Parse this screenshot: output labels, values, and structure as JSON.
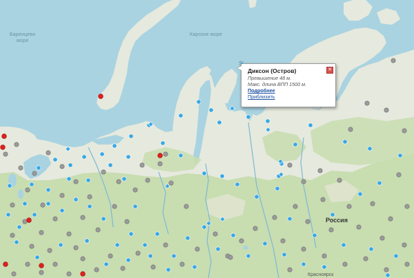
{
  "map": {
    "labels": {
      "sea_barents": "Баренцево\nморе",
      "sea_kara": "Карское море",
      "country_russia": "Россия",
      "city_krasnoyarsk": "Красноярск"
    },
    "colors": {
      "water": "#a9d3e1",
      "land_light": "#e6e9dd",
      "land_green": "#c8ddb0",
      "marker_blue": "#3aa8e3",
      "marker_gray": "#9b9b9b",
      "marker_red": "#e02020"
    }
  },
  "popup": {
    "title": "Диксон (Остров)",
    "elevation": "Превышение 48 м.",
    "runway": "Макс. длина ВПП 1500 м.",
    "more_link": "Подробнее",
    "zoom_link": "Приблизить",
    "close_icon": "close-icon"
  },
  "markers": {
    "legend": {
      "blue": "airport-marker",
      "gray": "airfield-marker",
      "red": "closed-marker"
    }
  }
}
